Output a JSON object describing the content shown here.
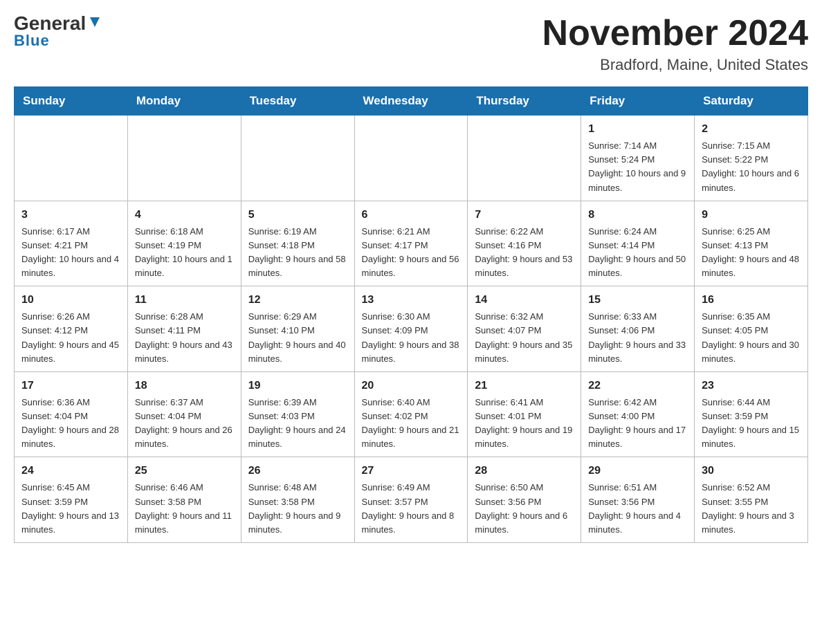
{
  "logo": {
    "general": "General",
    "blue": "Blue"
  },
  "header": {
    "title": "November 2024",
    "subtitle": "Bradford, Maine, United States"
  },
  "weekdays": [
    "Sunday",
    "Monday",
    "Tuesday",
    "Wednesday",
    "Thursday",
    "Friday",
    "Saturday"
  ],
  "weeks": [
    [
      {
        "day": "",
        "info": ""
      },
      {
        "day": "",
        "info": ""
      },
      {
        "day": "",
        "info": ""
      },
      {
        "day": "",
        "info": ""
      },
      {
        "day": "",
        "info": ""
      },
      {
        "day": "1",
        "info": "Sunrise: 7:14 AM\nSunset: 5:24 PM\nDaylight: 10 hours and 9 minutes."
      },
      {
        "day": "2",
        "info": "Sunrise: 7:15 AM\nSunset: 5:22 PM\nDaylight: 10 hours and 6 minutes."
      }
    ],
    [
      {
        "day": "3",
        "info": "Sunrise: 6:17 AM\nSunset: 4:21 PM\nDaylight: 10 hours and 4 minutes."
      },
      {
        "day": "4",
        "info": "Sunrise: 6:18 AM\nSunset: 4:19 PM\nDaylight: 10 hours and 1 minute."
      },
      {
        "day": "5",
        "info": "Sunrise: 6:19 AM\nSunset: 4:18 PM\nDaylight: 9 hours and 58 minutes."
      },
      {
        "day": "6",
        "info": "Sunrise: 6:21 AM\nSunset: 4:17 PM\nDaylight: 9 hours and 56 minutes."
      },
      {
        "day": "7",
        "info": "Sunrise: 6:22 AM\nSunset: 4:16 PM\nDaylight: 9 hours and 53 minutes."
      },
      {
        "day": "8",
        "info": "Sunrise: 6:24 AM\nSunset: 4:14 PM\nDaylight: 9 hours and 50 minutes."
      },
      {
        "day": "9",
        "info": "Sunrise: 6:25 AM\nSunset: 4:13 PM\nDaylight: 9 hours and 48 minutes."
      }
    ],
    [
      {
        "day": "10",
        "info": "Sunrise: 6:26 AM\nSunset: 4:12 PM\nDaylight: 9 hours and 45 minutes."
      },
      {
        "day": "11",
        "info": "Sunrise: 6:28 AM\nSunset: 4:11 PM\nDaylight: 9 hours and 43 minutes."
      },
      {
        "day": "12",
        "info": "Sunrise: 6:29 AM\nSunset: 4:10 PM\nDaylight: 9 hours and 40 minutes."
      },
      {
        "day": "13",
        "info": "Sunrise: 6:30 AM\nSunset: 4:09 PM\nDaylight: 9 hours and 38 minutes."
      },
      {
        "day": "14",
        "info": "Sunrise: 6:32 AM\nSunset: 4:07 PM\nDaylight: 9 hours and 35 minutes."
      },
      {
        "day": "15",
        "info": "Sunrise: 6:33 AM\nSunset: 4:06 PM\nDaylight: 9 hours and 33 minutes."
      },
      {
        "day": "16",
        "info": "Sunrise: 6:35 AM\nSunset: 4:05 PM\nDaylight: 9 hours and 30 minutes."
      }
    ],
    [
      {
        "day": "17",
        "info": "Sunrise: 6:36 AM\nSunset: 4:04 PM\nDaylight: 9 hours and 28 minutes."
      },
      {
        "day": "18",
        "info": "Sunrise: 6:37 AM\nSunset: 4:04 PM\nDaylight: 9 hours and 26 minutes."
      },
      {
        "day": "19",
        "info": "Sunrise: 6:39 AM\nSunset: 4:03 PM\nDaylight: 9 hours and 24 minutes."
      },
      {
        "day": "20",
        "info": "Sunrise: 6:40 AM\nSunset: 4:02 PM\nDaylight: 9 hours and 21 minutes."
      },
      {
        "day": "21",
        "info": "Sunrise: 6:41 AM\nSunset: 4:01 PM\nDaylight: 9 hours and 19 minutes."
      },
      {
        "day": "22",
        "info": "Sunrise: 6:42 AM\nSunset: 4:00 PM\nDaylight: 9 hours and 17 minutes."
      },
      {
        "day": "23",
        "info": "Sunrise: 6:44 AM\nSunset: 3:59 PM\nDaylight: 9 hours and 15 minutes."
      }
    ],
    [
      {
        "day": "24",
        "info": "Sunrise: 6:45 AM\nSunset: 3:59 PM\nDaylight: 9 hours and 13 minutes."
      },
      {
        "day": "25",
        "info": "Sunrise: 6:46 AM\nSunset: 3:58 PM\nDaylight: 9 hours and 11 minutes."
      },
      {
        "day": "26",
        "info": "Sunrise: 6:48 AM\nSunset: 3:58 PM\nDaylight: 9 hours and 9 minutes."
      },
      {
        "day": "27",
        "info": "Sunrise: 6:49 AM\nSunset: 3:57 PM\nDaylight: 9 hours and 8 minutes."
      },
      {
        "day": "28",
        "info": "Sunrise: 6:50 AM\nSunset: 3:56 PM\nDaylight: 9 hours and 6 minutes."
      },
      {
        "day": "29",
        "info": "Sunrise: 6:51 AM\nSunset: 3:56 PM\nDaylight: 9 hours and 4 minutes."
      },
      {
        "day": "30",
        "info": "Sunrise: 6:52 AM\nSunset: 3:55 PM\nDaylight: 9 hours and 3 minutes."
      }
    ]
  ]
}
